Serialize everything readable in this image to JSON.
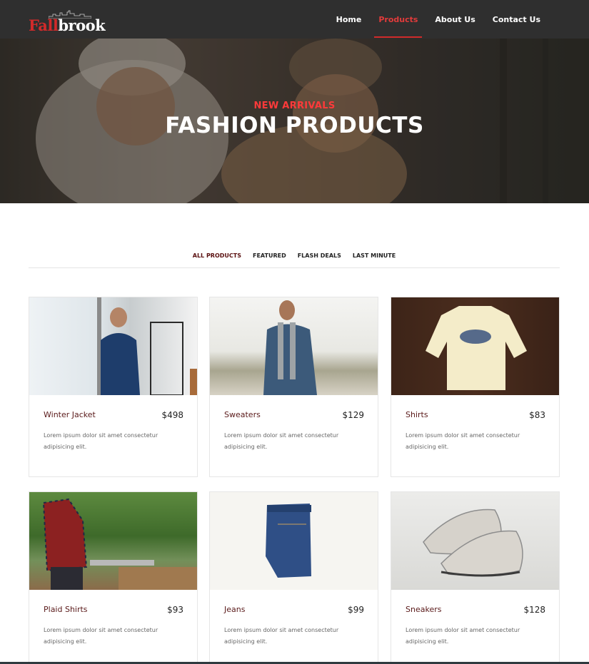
{
  "brand": {
    "logo_red": "Fall",
    "logo_white": "brook"
  },
  "nav": {
    "items": [
      {
        "label": "Home",
        "active": false
      },
      {
        "label": "Products",
        "active": true
      },
      {
        "label": "About Us",
        "active": false
      },
      {
        "label": "Contact Us",
        "active": false
      }
    ]
  },
  "hero": {
    "subtitle": "NEW ARRIVALS",
    "title": "FASHION PRODUCTS"
  },
  "filters": [
    {
      "label": "ALL PRODUCTS",
      "active": true
    },
    {
      "label": "FEATURED",
      "active": false
    },
    {
      "label": "FLASH DEALS",
      "active": false
    },
    {
      "label": "LAST MINUTE",
      "active": false
    }
  ],
  "products": [
    {
      "name": "Winter Jacket",
      "price": "$498",
      "desc": "Lorem ipsum dolor sit amet consectetur adipisicing elit."
    },
    {
      "name": "Sweaters",
      "price": "$129",
      "desc": "Lorem ipsum dolor sit amet consectetur adipisicing elit."
    },
    {
      "name": "Shirts",
      "price": "$83",
      "desc": "Lorem ipsum dolor sit amet consectetur adipisicing elit."
    },
    {
      "name": "Plaid Shirts",
      "price": "$93",
      "desc": "Lorem ipsum dolor sit amet consectetur adipisicing elit."
    },
    {
      "name": "Jeans",
      "price": "$99",
      "desc": "Lorem ipsum dolor sit amet consectetur adipisicing elit."
    },
    {
      "name": "Sneakers",
      "price": "$128",
      "desc": "Lorem ipsum dolor sit amet consectetur adipisicing elit."
    }
  ],
  "colors": {
    "accent": "#d12a2a",
    "header_bg": "#2f2f2f"
  }
}
